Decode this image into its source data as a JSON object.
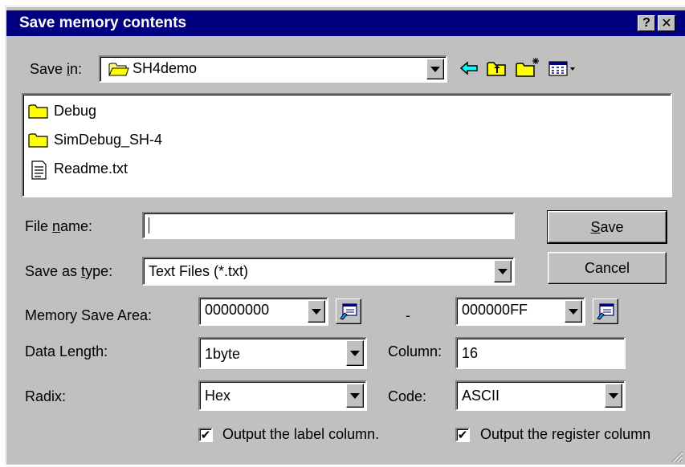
{
  "window": {
    "title": "Save memory contents",
    "help_button": "?",
    "close_button": "✕"
  },
  "save_in": {
    "label_prefix": "Save ",
    "label_mnemonic": "i",
    "label_suffix": "n:",
    "value": "SH4demo"
  },
  "file_list": {
    "items": [
      {
        "name": "Debug",
        "type": "folder"
      },
      {
        "name": "SimDebug_SH-4",
        "type": "folder"
      },
      {
        "name": "Readme.txt",
        "type": "text-file"
      }
    ]
  },
  "file_name": {
    "label_prefix": "File ",
    "label_mnemonic": "n",
    "label_suffix": "ame:",
    "value": ""
  },
  "save_as_type": {
    "label_prefix": "Save as ",
    "label_mnemonic": "t",
    "label_suffix": "ype:",
    "value": "Text Files (*.txt)"
  },
  "buttons": {
    "save_mnemonic": "S",
    "save_rest": "ave",
    "cancel": "Cancel"
  },
  "memory_save_area": {
    "label": "Memory Save Area:",
    "start": "00000000",
    "separator": "-",
    "end": "000000FF"
  },
  "data_length": {
    "label": "Data Length:",
    "value": "1byte"
  },
  "column": {
    "label": "Column:",
    "value": "16"
  },
  "radix": {
    "label": "Radix:",
    "value": "Hex"
  },
  "code": {
    "label": "Code:",
    "value": "ASCII"
  },
  "checkboxes": {
    "label_column": {
      "label": "Output the label column.",
      "checked": true
    },
    "register_column": {
      "label": "Output the register column",
      "checked": true
    }
  }
}
